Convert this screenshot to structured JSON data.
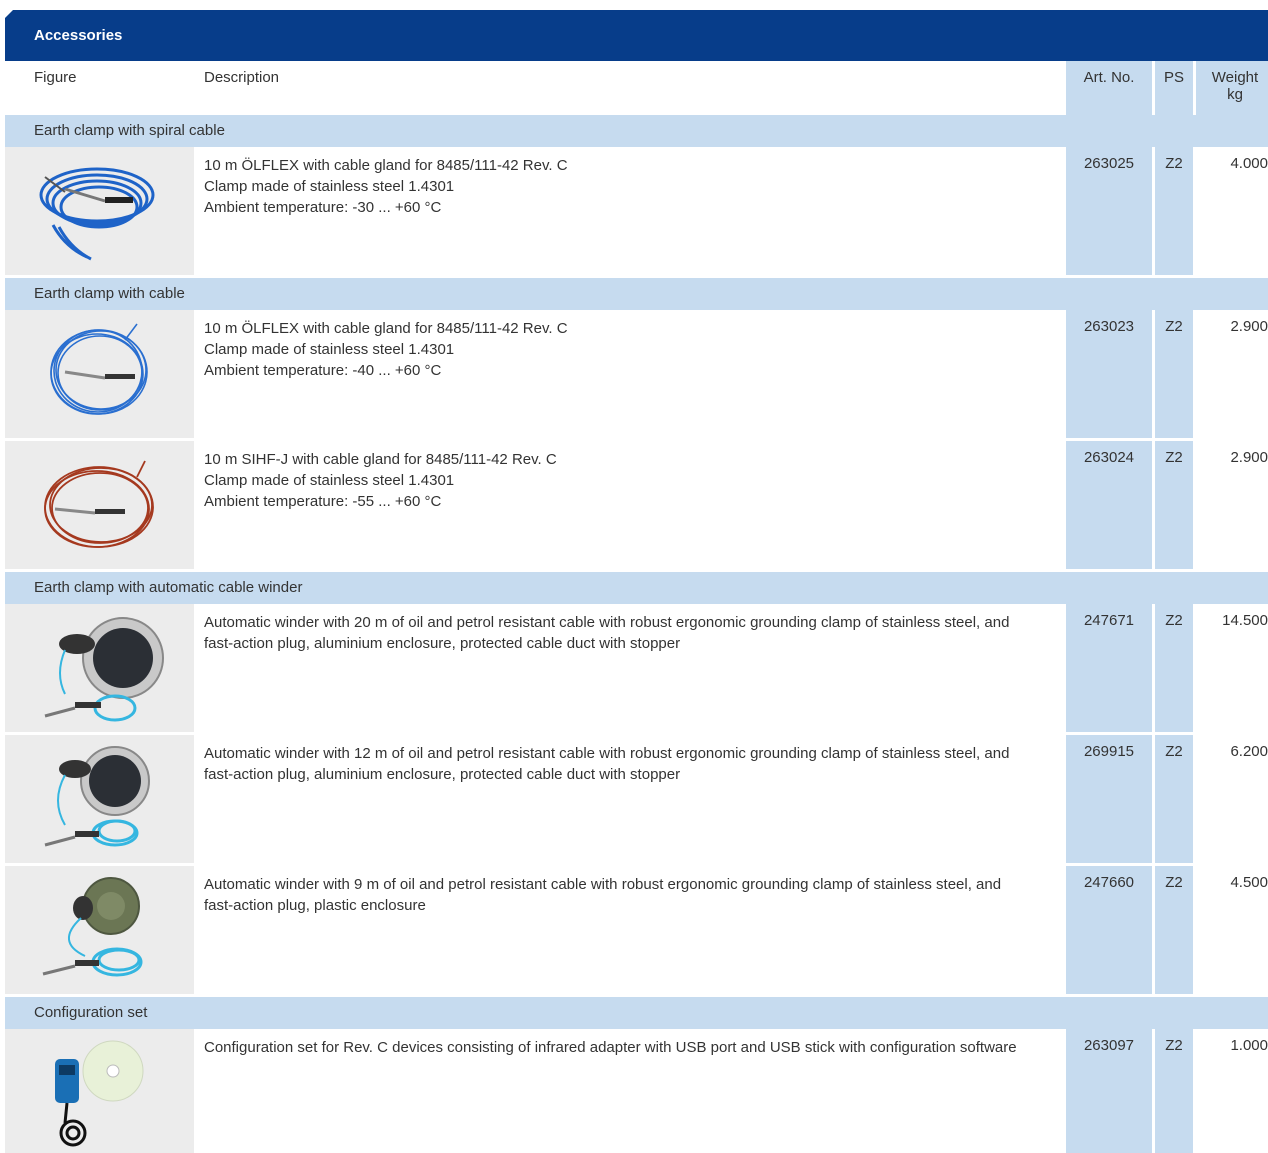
{
  "section": {
    "title": "Accessories"
  },
  "columns": {
    "figure": "Figure",
    "description": "Description",
    "art_no": "Art. No.",
    "ps": "PS",
    "weight_line1": "Weight",
    "weight_line2": "kg"
  },
  "groups": [
    {
      "title": "Earth clamp with spiral cable",
      "rows": [
        {
          "figure_icon": "spiral-cable-clamp-icon",
          "desc": [
            "10 m ÖLFLEX with cable gland for 8485/111-42 Rev. C",
            "Clamp made of stainless steel 1.4301",
            "Ambient temperature: -30 ... +60 °C"
          ],
          "art_no": "263025",
          "ps": "Z2",
          "weight": "4.000"
        }
      ]
    },
    {
      "title": "Earth clamp with cable",
      "rows": [
        {
          "figure_icon": "blue-cable-clamp-icon",
          "desc": [
            "10 m ÖLFLEX with cable gland for 8485/111-42 Rev. C",
            "Clamp made of stainless steel 1.4301",
            "Ambient temperature: -40 ... +60 °C"
          ],
          "art_no": "263023",
          "ps": "Z2",
          "weight": "2.900"
        },
        {
          "figure_icon": "red-cable-clamp-icon",
          "desc": [
            "10 m SIHF-J with cable gland for 8485/111-42 Rev. C",
            "Clamp made of stainless steel 1.4301",
            "Ambient temperature: -55 ... +60 °C"
          ],
          "art_no": "263024",
          "ps": "Z2",
          "weight": "2.900"
        }
      ]
    },
    {
      "title": "Earth clamp with automatic cable winder",
      "rows": [
        {
          "figure_icon": "cable-winder-aluminium-icon",
          "desc": [
            "Automatic winder with 20 m of oil and petrol resistant cable with robust ergonomic grounding clamp of stainless steel, and",
            "fast-action plug, aluminium enclosure, protected cable duct with stopper"
          ],
          "art_no": "247671",
          "ps": "Z2",
          "weight": "14.500"
        },
        {
          "figure_icon": "cable-winder-aluminium-icon",
          "desc": [
            "Automatic winder with 12 m of oil and petrol resistant cable with robust ergonomic grounding clamp of stainless steel, and",
            "fast-action plug, aluminium enclosure, protected cable duct with stopper"
          ],
          "art_no": "269915",
          "ps": "Z2",
          "weight": "6.200"
        },
        {
          "figure_icon": "cable-winder-plastic-icon",
          "desc": [
            "Automatic winder with 9 m of oil and petrol resistant cable with robust ergonomic grounding clamp of stainless steel, and",
            "fast-action plug, plastic enclosure"
          ],
          "art_no": "247660",
          "ps": "Z2",
          "weight": "4.500"
        }
      ]
    },
    {
      "title": "Configuration set",
      "rows": [
        {
          "figure_icon": "configuration-set-icon",
          "desc": [
            "Configuration set for Rev. C devices consisting of infrared adapter with USB port and USB stick with configuration software"
          ],
          "art_no": "263097",
          "ps": "Z2",
          "weight": "1.000"
        }
      ]
    }
  ]
}
